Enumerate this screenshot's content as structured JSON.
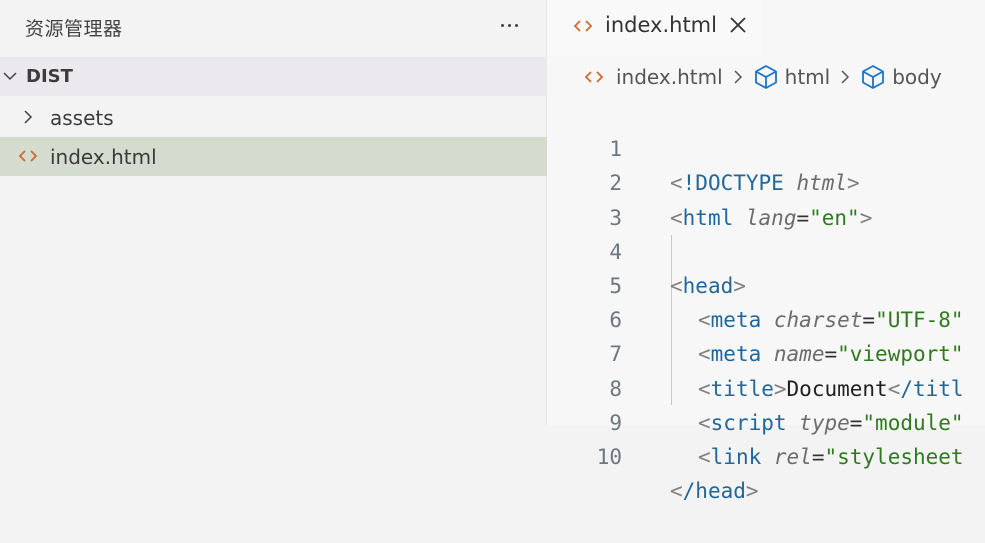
{
  "sidebar": {
    "title": "资源管理器",
    "more_icon": "ellipsis-icon",
    "folder": {
      "name": "DIST",
      "expanded": true
    },
    "items": [
      {
        "name": "assets",
        "type": "folder",
        "icon": "chevron-right-icon"
      },
      {
        "name": "index.html",
        "type": "file",
        "icon": "html-file-icon",
        "selected": true
      }
    ]
  },
  "editor": {
    "tab": {
      "label": "index.html",
      "close_icon": "close-icon"
    },
    "breadcrumb": [
      "index.html",
      "html",
      "body"
    ],
    "lines": [
      {
        "n": "1"
      },
      {
        "n": "2"
      },
      {
        "n": "3"
      },
      {
        "n": "4"
      },
      {
        "n": "5"
      },
      {
        "n": "6"
      },
      {
        "n": "7"
      },
      {
        "n": "8"
      },
      {
        "n": "9"
      },
      {
        "n": "10"
      }
    ],
    "code": {
      "doctype": "!DOCTYPE",
      "doctype_attr": "html",
      "html_tag": "html",
      "lang_attr": "lang",
      "lang_val": "\"en\"",
      "head_tag": "head",
      "meta_tag": "meta",
      "charset_attr": "charset",
      "charset_val": "\"UTF-8\"",
      "name_attr": "name",
      "name_val": "\"viewport\"",
      "title_tag": "title",
      "title_text": "Document",
      "title_close": "/titl",
      "script_tag": "script",
      "type_attr": "type",
      "type_val": "\"module\"",
      "link_tag": "link",
      "rel_attr": "rel",
      "rel_val": "\"stylesheet",
      "head_close": "/head"
    }
  },
  "colors": {
    "tag": "#22669a",
    "string": "#2f7a1f",
    "attribute": "#6c6c6c",
    "html_icon": "#d06a30",
    "cube_icon": "#1a74c4",
    "selection": "#d4dbcf"
  }
}
